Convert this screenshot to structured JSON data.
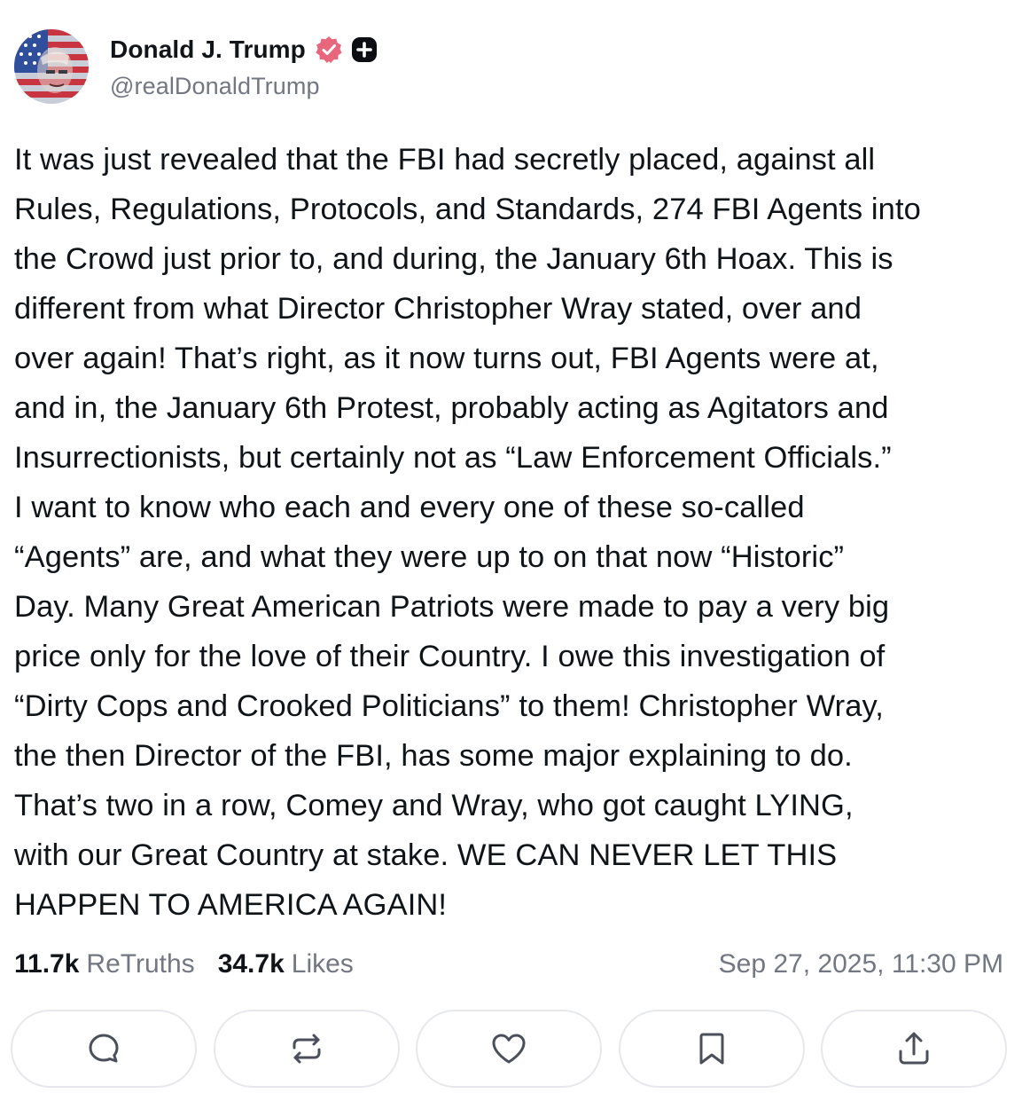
{
  "author": {
    "display_name": "Donald J. Trump",
    "handle": "@realDonaldTrump",
    "avatar_icon": "flag-portrait-avatar",
    "badges": [
      "verified-badge-icon",
      "plus-badge-icon"
    ]
  },
  "post": {
    "text": "It was just revealed that the FBI had secretly placed, against all\nRules, Regulations, Protocols, and Standards, 274 FBI Agents into\nthe Crowd just prior to, and during, the January 6th Hoax. This is\ndifferent from what Director Christopher Wray stated, over and\nover again! That’s right, as it now turns out, FBI Agents were at,\nand in, the January 6th Protest, probably acting as Agitators and\nInsurrectionists, but certainly not as “Law Enforcement Officials.”\nI want to know who each and every one of these so-called\n“Agents” are, and what they were up to on that now “Historic”\nDay. Many Great American Patriots were made to pay a very big\nprice only for the love of their Country. I owe this investigation of\n“Dirty Cops and Crooked Politicians” to them! Christopher Wray,\nthe then Director of the FBI, has some major explaining to do.\nThat’s two in a row, Comey and Wray, who got caught LYING,\nwith our Great Country at stake. WE CAN NEVER LET THIS\nHAPPEN TO AMERICA AGAIN!"
  },
  "stats": {
    "retruths_count": "11.7k",
    "retruths_label": "ReTruths",
    "likes_count": "34.7k",
    "likes_label": "Likes",
    "timestamp": "Sep 27, 2025, 11:30 PM"
  },
  "actions": [
    {
      "icon": "reply-icon"
    },
    {
      "icon": "retruth-icon"
    },
    {
      "icon": "heart-icon"
    },
    {
      "icon": "bookmark-icon"
    },
    {
      "icon": "share-icon"
    }
  ],
  "colors": {
    "verified": "#e9677c",
    "muted_text": "#727782",
    "button_border": "#e6e8ec",
    "icon_stroke": "#4a4f5a"
  }
}
